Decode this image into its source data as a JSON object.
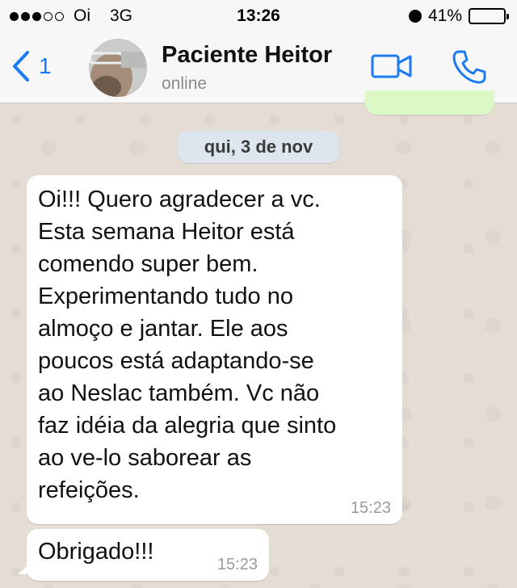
{
  "status_bar": {
    "carrier": "Oi",
    "network": "3G",
    "time": "13:26",
    "battery": "41%",
    "signal_bars_filled": 3,
    "signal_bars_total": 5
  },
  "header": {
    "back_count": "1",
    "contact_name": "Paciente Heitor",
    "contact_status": "online",
    "icons": [
      "chevron-left-icon",
      "video-call-icon",
      "phone-icon"
    ],
    "accent_color": "#1a7cf5"
  },
  "chat": {
    "date_label": "qui, 3 de nov",
    "messages": [
      {
        "text": "Oi!!!  Quero agradecer a vc.\nEsta semana Heitor está\ncomendo super bem.\nExperimentando tudo no\nalmoço e jantar.  Ele aos\npoucos está adaptando-se\nao Neslac também.  Vc não\nfaz idéia da alegria que sinto\nao ve-lo saborear as\nrefeições.",
        "time": "15:23"
      },
      {
        "text": "Obrigado!!!",
        "time": "15:23"
      }
    ]
  }
}
